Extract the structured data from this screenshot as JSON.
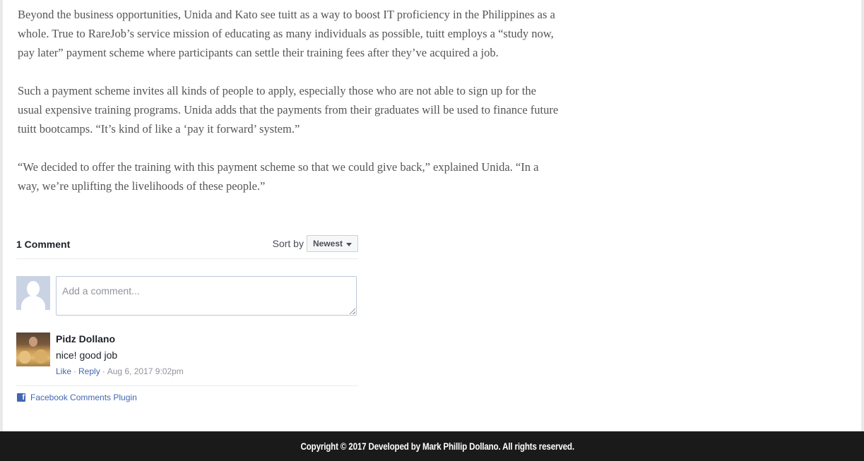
{
  "article": {
    "paragraphs": [
      "Beyond the business opportunities, Unida and Kato see tuitt as a way to boost IT proficiency in the Philippines as a whole. True to RareJob’s service mission of educating as many individuals as possible, tuitt employs a “study now, pay later” payment scheme where participants can settle their training fees after they’ve acquired a job.",
      "Such a payment scheme invites all kinds of people to apply, especially those who are not able to sign up for the usual expensive training programs. Unida adds that the payments from their graduates will be used to finance future tuitt bootcamps. “It’s kind of like a ‘pay it forward’ system.”",
      "“We decided to offer the training with this payment scheme so that we could give back,” explained Unida. “In a way, we’re uplifting the livelihoods of these people.”"
    ]
  },
  "comments": {
    "count_label": "1 Comment",
    "sort_label": "Sort by",
    "sort_value": "Newest",
    "compose_placeholder": "Add a comment...",
    "items": [
      {
        "author": "Pidz Dollano",
        "text": "nice! good job",
        "like_label": "Like",
        "reply_label": "Reply",
        "timestamp": "Aug 6, 2017 9:02pm"
      }
    ],
    "plugin_label": "Facebook Comments Plugin"
  },
  "footer": {
    "copyright": "Copyright © 2017 Developed by Mark Phillip Dollano. All rights reserved."
  },
  "icons": {
    "facebook": "facebook-icon",
    "sort_caret": "chevron-down-icon"
  },
  "colors": {
    "link": "#4267b2",
    "footer_bg": "#1a1a1a",
    "body_text": "#555555"
  }
}
